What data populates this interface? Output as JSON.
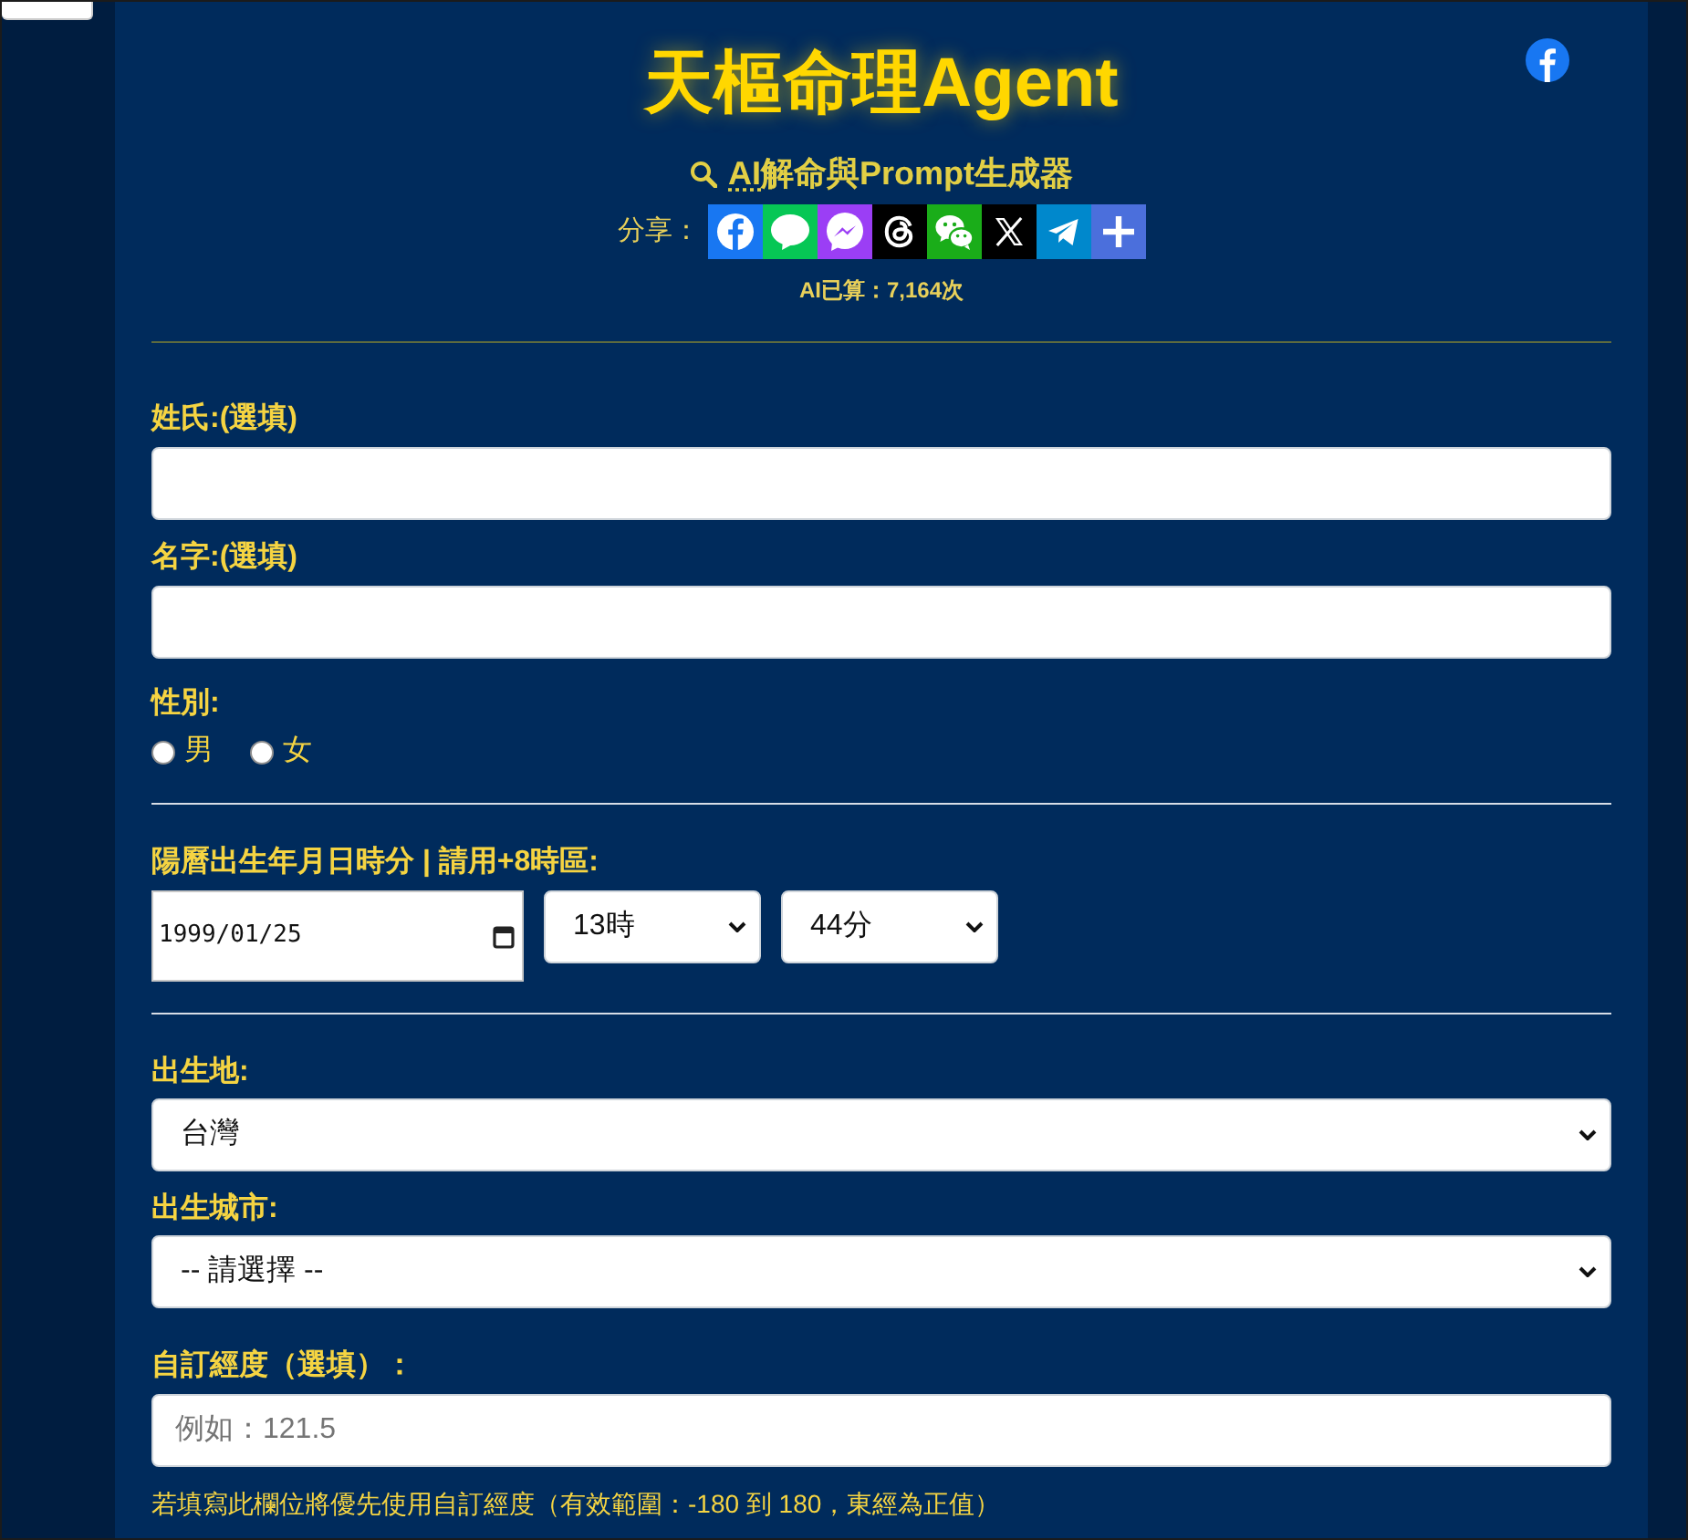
{
  "header": {
    "title": "天樞命理Agent",
    "subtitle": {
      "abbr": "AI",
      "text": "解命與Prompt生成器"
    },
    "share_label": "分享：",
    "counter": "AI已算：7,164次"
  },
  "form": {
    "sections": [
      {
        "fields": [
          {
            "kind": "text",
            "label": "姓氏:(選填)"
          },
          {
            "kind": "text",
            "label": "名字:(選填)"
          },
          {
            "kind": "radio",
            "label": "性別:",
            "options": [
              {
                "label": "男",
                "selected": false
              },
              {
                "label": "女",
                "selected": false
              }
            ]
          }
        ]
      },
      {
        "fields": [
          {
            "kind": "datetime",
            "label": "陽曆出生年月日時分 | 請用+8時區:",
            "date": "1999/01/25",
            "hour": "13時",
            "minute": "44分"
          }
        ]
      },
      {
        "fields": [
          {
            "kind": "select",
            "label": "出生地:",
            "value": "台灣"
          },
          {
            "kind": "select",
            "label": "出生城市:",
            "value": "-- 請選擇 --"
          },
          {
            "kind": "number",
            "label": "自訂經度（選填）：",
            "placeholder": "例如：121.5",
            "note": "若填寫此欄位將優先使用自訂經度（有效範圍：-180 到 180，東經為正值）"
          }
        ]
      }
    ]
  }
}
